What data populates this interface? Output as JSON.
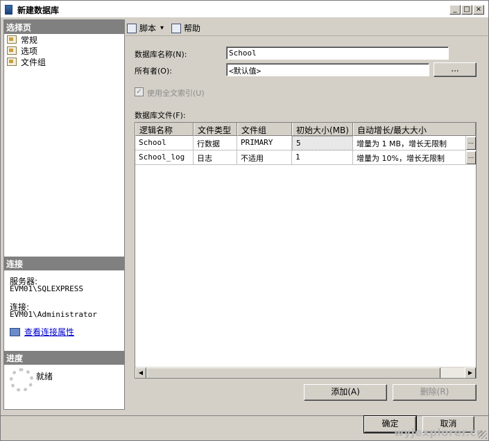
{
  "window": {
    "title": "新建数据库",
    "min_label": "_",
    "max_label": "□",
    "close_label": "×"
  },
  "left_pane": {
    "select_page_header": "选择页",
    "pages": [
      {
        "label": "常规",
        "icon": "page-icon"
      },
      {
        "label": "选项",
        "icon": "page-icon"
      },
      {
        "label": "文件组",
        "icon": "page-icon"
      }
    ],
    "connection_header": "连接",
    "server_label": "服务器:",
    "server_value": "EVM01\\SQLEXPRESS",
    "connection_label": "连接:",
    "connection_value": "EVM01\\Administrator",
    "view_props_link": "查看连接属性",
    "progress_header": "进度",
    "progress_status": "就绪"
  },
  "toolbar": {
    "script_label": "脚本",
    "dropdown_arrow": "▾",
    "help_label": "帮助"
  },
  "form": {
    "db_name_label": "数据库名称(N):",
    "db_name_value": "School",
    "owner_label": "所有者(O):",
    "owner_value": "<默认值>",
    "owner_browse_label": "...",
    "fulltext_label": "使用全文索引(U)",
    "fulltext_checked": true,
    "db_files_label": "数据库文件(F):"
  },
  "grid": {
    "columns": [
      "逻辑名称",
      "文件类型",
      "文件组",
      "初始大小(MB)",
      "自动增长/最大大小"
    ],
    "rows": [
      {
        "logical_name": "School",
        "file_type": "行数据",
        "filegroup": "PRIMARY",
        "initial_size": "5",
        "autogrowth": "增量为 1 MB，增长无限制",
        "ellipsis": "..."
      },
      {
        "logical_name": "School_log",
        "file_type": "日志",
        "filegroup": "不适用",
        "initial_size": "1",
        "autogrowth": "增量为 10%，增长无限制",
        "ellipsis": "..."
      }
    ],
    "scroll_left": "◀",
    "scroll_right": "▶"
  },
  "buttons": {
    "add_label": "添加(A)",
    "remove_label": "删除(R)",
    "ok_label": "确定",
    "cancel_label": "取消"
  },
  "watermark": "wyjexplorer.cn"
}
